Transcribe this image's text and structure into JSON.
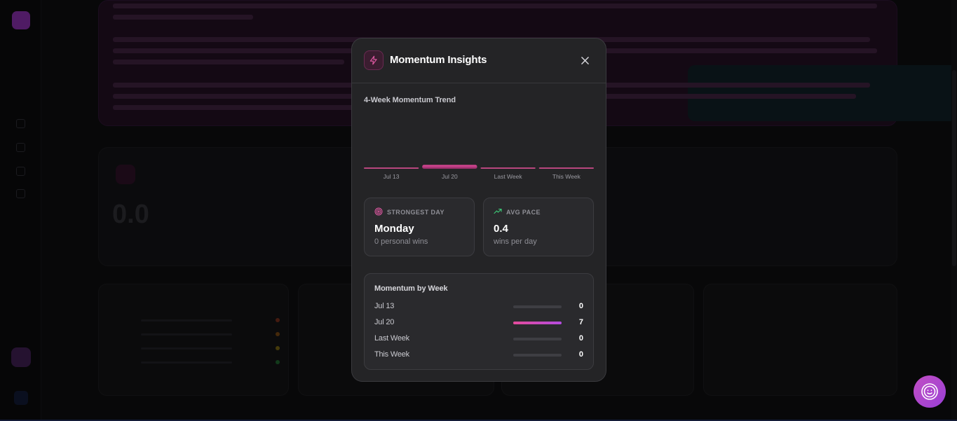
{
  "modal": {
    "title": "Momentum Insights",
    "icon": "lightning-icon",
    "close_icon": "close-icon"
  },
  "trend": {
    "title": "4-Week Momentum Trend"
  },
  "chart_data": {
    "type": "bar",
    "categories": [
      "Jul 13",
      "Jul 20",
      "Last Week",
      "This Week"
    ],
    "values": [
      0,
      7,
      0,
      0
    ],
    "title": "4-Week Momentum Trend",
    "xlabel": "",
    "ylabel": "",
    "grid": false
  },
  "stats": {
    "strongest_day": {
      "label": "STRONGEST DAY",
      "value": "Monday",
      "sub": "0 personal wins",
      "icon": "target-icon"
    },
    "avg_pace": {
      "label": "AVG PACE",
      "value": "0.4",
      "sub": "wins per day",
      "icon": "trending-up-icon"
    }
  },
  "weeks": {
    "title": "Momentum by Week",
    "max": 7,
    "rows": [
      {
        "label": "Jul 13",
        "value": 0
      },
      {
        "label": "Jul 20",
        "value": 7
      },
      {
        "label": "Last Week",
        "value": 0
      },
      {
        "label": "This Week",
        "value": 0
      }
    ]
  },
  "colors": {
    "accent_pink": "#e44b9b",
    "accent_purple": "#b44be0",
    "positive_green": "#3ecf7a",
    "modal_bg": "#242426"
  }
}
